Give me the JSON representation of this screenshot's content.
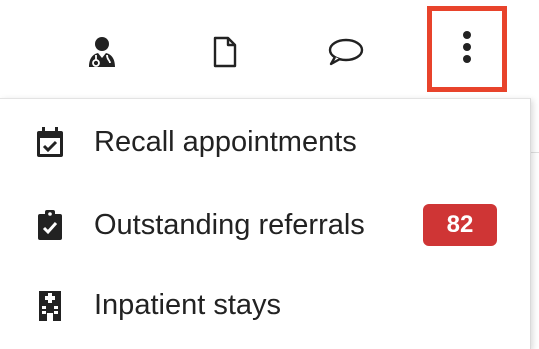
{
  "toolbar": {
    "buttons": [
      {
        "name": "doctor",
        "icon": "user-doctor-icon"
      },
      {
        "name": "document",
        "icon": "file-icon"
      },
      {
        "name": "message",
        "icon": "comment-icon"
      },
      {
        "name": "more",
        "icon": "ellipsis-vertical-icon"
      }
    ],
    "highlight_color": "#e8432b"
  },
  "menu": {
    "items": [
      {
        "label": "Recall appointments",
        "icon": "calendar-check-icon"
      },
      {
        "label": "Outstanding referrals",
        "icon": "clipboard-check-icon",
        "badge": "82"
      },
      {
        "label": "Inpatient stays",
        "icon": "hospital-icon"
      }
    ],
    "badge_color": "#cf3535"
  }
}
